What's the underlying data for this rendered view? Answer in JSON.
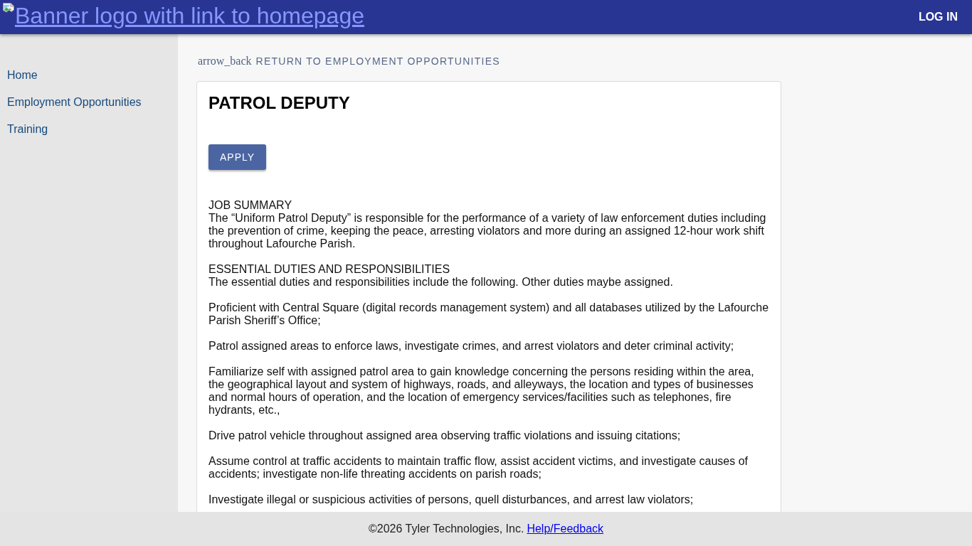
{
  "header": {
    "logo_alt": "Banner logo with link to homepage",
    "login": "LOG IN"
  },
  "sidebar": {
    "items": [
      "Home",
      "Employment Opportunities",
      "Training"
    ]
  },
  "back_link": {
    "icon_text": "arrow_back",
    "label": "RETURN TO EMPLOYMENT OPPORTUNITIES"
  },
  "job": {
    "title": "PATROL DEPUTY",
    "apply_button": "APPLY",
    "description": [
      {
        "heading": "JOB SUMMARY",
        "text": "The “Uniform Patrol Deputy” is responsible for the performance of a variety of law enforcement duties including the prevention of crime, keeping the peace, arresting violators and more during an assigned 12-hour work shift throughout Lafourche Parish."
      },
      {
        "heading": "ESSENTIAL DUTIES AND RESPONSIBILITIES",
        "text": "The essential duties and responsibilities include the following. Other duties maybe assigned."
      },
      {
        "text": "Proficient with Central Square (digital records management system) and all databases utilized by the Lafourche Parish Sheriff’s Office;"
      },
      {
        "text": "Patrol assigned areas to enforce laws, investigate crimes, and arrest violators and deter criminal activity;"
      },
      {
        "text": "Familiarize self with assigned patrol area to gain knowledge concerning the persons residing within the area, the geographical layout and system of highways, roads, and alleyways, the location and types of businesses and normal hours of operation, and the location of emergency services/facilities such as telephones, fire hydrants, etc.,"
      },
      {
        "text": "Drive patrol vehicle throughout assigned area observing traffic violations and issuing citations;"
      },
      {
        "text": "Assume control at traffic accidents to maintain traffic flow, assist accident victims, and investigate causes of accidents; investigate non-life threating accidents on parish roads;"
      },
      {
        "text": "Investigate illegal or suspicious activities of persons, quell disturbances, and arrest law violators;"
      }
    ]
  },
  "footer": {
    "copyright": "©2026 Tyler Technologies, Inc.",
    "link": "Help/Feedback"
  }
}
